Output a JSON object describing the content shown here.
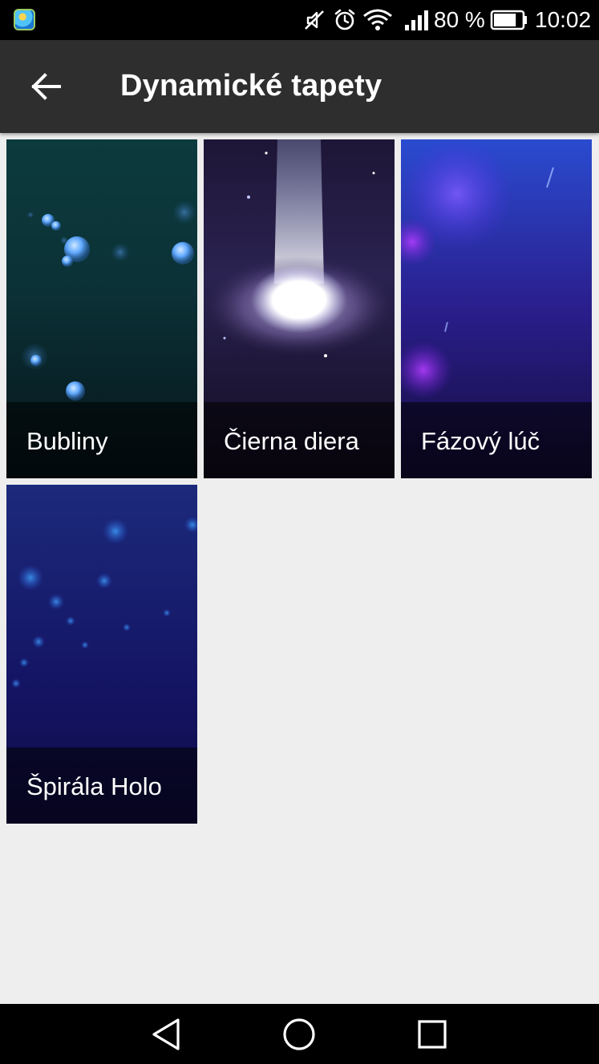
{
  "status_bar": {
    "battery_percent": "80 %",
    "time": "10:02",
    "icons": [
      "app-notification-icon",
      "mute-icon",
      "alarm-icon",
      "wifi-icon",
      "signal-icon",
      "battery-icon"
    ],
    "battery_level": 0.8
  },
  "toolbar": {
    "title": "Dynamické tapety",
    "back_icon": "arrow-back-icon"
  },
  "wallpapers": [
    {
      "label": "Bubliny"
    },
    {
      "label": "Čierna diera"
    },
    {
      "label": "Fázový lúč"
    },
    {
      "label": "Špirála Holo"
    }
  ],
  "navigation": {
    "icons": [
      "back-triangle-icon",
      "home-circle-icon",
      "recents-square-icon"
    ]
  }
}
